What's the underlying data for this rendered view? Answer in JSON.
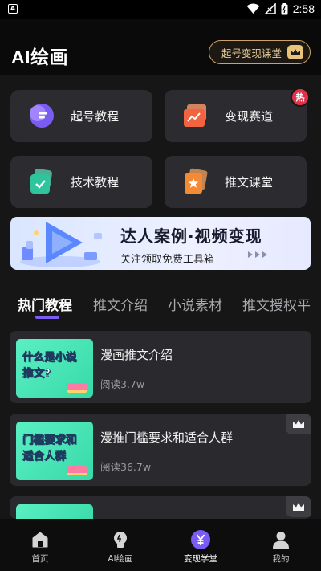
{
  "status_bar": {
    "time": "2:58",
    "notification_glyph": "A"
  },
  "header": {
    "title": "AI绘画",
    "vip_button_label": "起号变现课堂"
  },
  "tiles": [
    {
      "label": "起号教程",
      "icon": "tutorial-icon"
    },
    {
      "label": "变现赛道",
      "icon": "monetize-track-icon",
      "badge": "热"
    },
    {
      "label": "技术教程",
      "icon": "tech-tutorial-icon"
    },
    {
      "label": "推文课堂",
      "icon": "promo-class-icon"
    }
  ],
  "banner": {
    "title": "达人案例·视频变现",
    "subtitle": "关注领取免费工具箱"
  },
  "tabs": [
    "热门教程",
    "推文介绍",
    "小说素材",
    "推文授权平"
  ],
  "cards": [
    {
      "thumb_text": "什么是小说推文?",
      "title": "漫画推文介绍",
      "reads": "阅读3.7w",
      "premium": false
    },
    {
      "thumb_text": "门槛要求和适合人群",
      "title": "漫推门槛要求和适合人群",
      "reads": "阅读36.7w",
      "premium": true
    },
    {
      "thumb_text": "",
      "title": "",
      "reads": "",
      "premium": true
    }
  ],
  "bottom_nav": [
    {
      "label": "首页",
      "icon": "home-icon",
      "active": false
    },
    {
      "label": "AI绘画",
      "icon": "lightbulb-icon",
      "active": false
    },
    {
      "label": "变现学堂",
      "icon": "yen-icon",
      "active": true
    },
    {
      "label": "我的",
      "icon": "profile-icon",
      "active": false
    }
  ],
  "colors": {
    "accent": "#7b5cf2",
    "gold": "#e8c37a",
    "hot": "#e0324a",
    "thumb": "#5af0c3"
  }
}
